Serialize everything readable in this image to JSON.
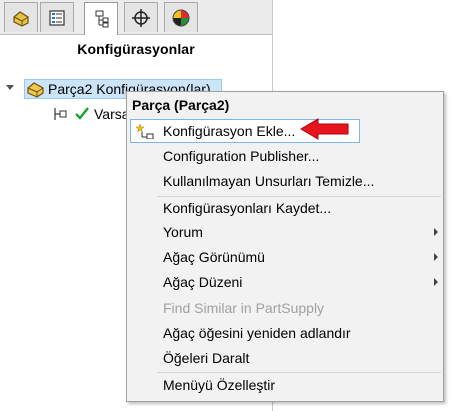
{
  "tabs": [
    {
      "icon": "feature-manager-icon"
    },
    {
      "icon": "property-manager-icon"
    },
    {
      "icon": "configuration-manager-icon",
      "active": true
    },
    {
      "icon": "dimxpert-icon"
    },
    {
      "icon": "display-manager-icon"
    }
  ],
  "panel": {
    "title": "Konfigürasyonlar"
  },
  "tree": {
    "root_label": "Parça2 Konfigürasyon(lar)",
    "child_label": "Varsa"
  },
  "menu": {
    "header": "Parça (Parça2)",
    "items": {
      "add_config": "Konfigürasyon Ekle...",
      "publisher": "Configuration Publisher...",
      "clean_features": "Kullanılmayan Unsurları Temizle...",
      "save_configs": "Konfigürasyonları Kaydet...",
      "comment": "Yorum",
      "tree_display": "Ağaç Görünümü",
      "tree_order": "Ağaç Düzeni",
      "find_similar": "Find Similar in PartSupply",
      "rename_tree": "Ağaç öğesini yeniden adlandır",
      "collapse": "Öğeleri Daralt",
      "customize": "Menüyü Özelleştir"
    }
  },
  "colors": {
    "highlight_bg": "#cce4f7",
    "menu_bg": "#f2f2f2",
    "annotation_arrow": "#e8141c",
    "check": "#1aa12c"
  }
}
